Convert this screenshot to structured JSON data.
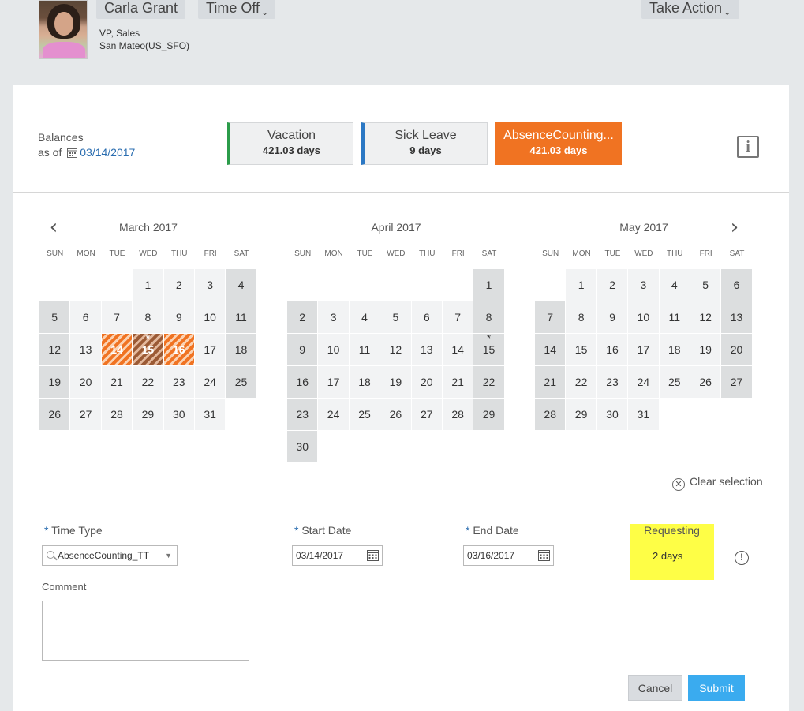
{
  "header": {
    "name": "Carla Grant",
    "time_off_label": "Time Off",
    "take_action_label": "Take Action",
    "chevron": "⌄",
    "title": "VP, Sales",
    "location": "San Mateo(US_SFO)"
  },
  "balances": {
    "label": "Balances",
    "as_of_label": "as of",
    "as_of_date": "03/14/2017",
    "tiles": [
      {
        "name": "Vacation",
        "value": "421.03 days",
        "accent": "#2b9c4a"
      },
      {
        "name": "Sick Leave",
        "value": "9 days",
        "accent": "#2b78c4"
      },
      {
        "name": "AbsenceCounting...",
        "value": "421.03 days",
        "accent": "#f07322"
      }
    ],
    "info_icon": "info-icon"
  },
  "calendar": {
    "prev_arrow": "‹",
    "next_arrow": "›",
    "dow": [
      "SUN",
      "MON",
      "TUE",
      "WED",
      "THU",
      "FRI",
      "SAT"
    ],
    "months": [
      {
        "title": "March 2017",
        "lead": 3,
        "days": [
          "1",
          "2",
          "3",
          "4",
          "5",
          "6",
          "7",
          "8",
          "9",
          "10",
          "11",
          "12",
          "13",
          "14",
          "15",
          "16",
          "17",
          "18",
          "19",
          "20",
          "21",
          "22",
          "23",
          "24",
          "25",
          "26",
          "27",
          "28",
          "29",
          "30",
          "31"
        ],
        "selected": [
          14,
          15,
          16
        ],
        "selected_mid": [
          15
        ],
        "marked": [
          15
        ]
      },
      {
        "title": "April 2017",
        "lead": 6,
        "days": [
          "1",
          "2",
          "3",
          "4",
          "5",
          "6",
          "7",
          "8",
          "9",
          "10",
          "11",
          "12",
          "13",
          "14",
          "15",
          "16",
          "17",
          "18",
          "19",
          "20",
          "21",
          "22",
          "23",
          "24",
          "25",
          "26",
          "27",
          "28",
          "29",
          "30"
        ],
        "selected": [],
        "selected_mid": [],
        "marked": [
          15
        ]
      },
      {
        "title": "May 2017",
        "lead": 1,
        "days": [
          "1",
          "2",
          "3",
          "4",
          "5",
          "6",
          "7",
          "8",
          "9",
          "10",
          "11",
          "12",
          "13",
          "14",
          "15",
          "16",
          "17",
          "18",
          "19",
          "20",
          "21",
          "22",
          "23",
          "24",
          "25",
          "26",
          "27",
          "28",
          "29",
          "30",
          "31"
        ],
        "selected": [],
        "selected_mid": [],
        "marked": []
      }
    ],
    "mark_symbol": "*",
    "clear_selection": "Clear selection",
    "selection_color": "#f07322"
  },
  "form": {
    "required_marker": "*",
    "time_type_label": "Time Type",
    "time_type_value": "AbsenceCounting_TT",
    "start_date_label": "Start Date",
    "start_date_value": "03/14/2017",
    "end_date_label": "End Date",
    "end_date_value": "03/16/2017",
    "requesting_label": "Requesting",
    "requesting_value": "2 days",
    "comment_label": "Comment",
    "comment_value": "",
    "cancel_label": "Cancel",
    "submit_label": "Submit",
    "submit_color": "#3aabef"
  }
}
